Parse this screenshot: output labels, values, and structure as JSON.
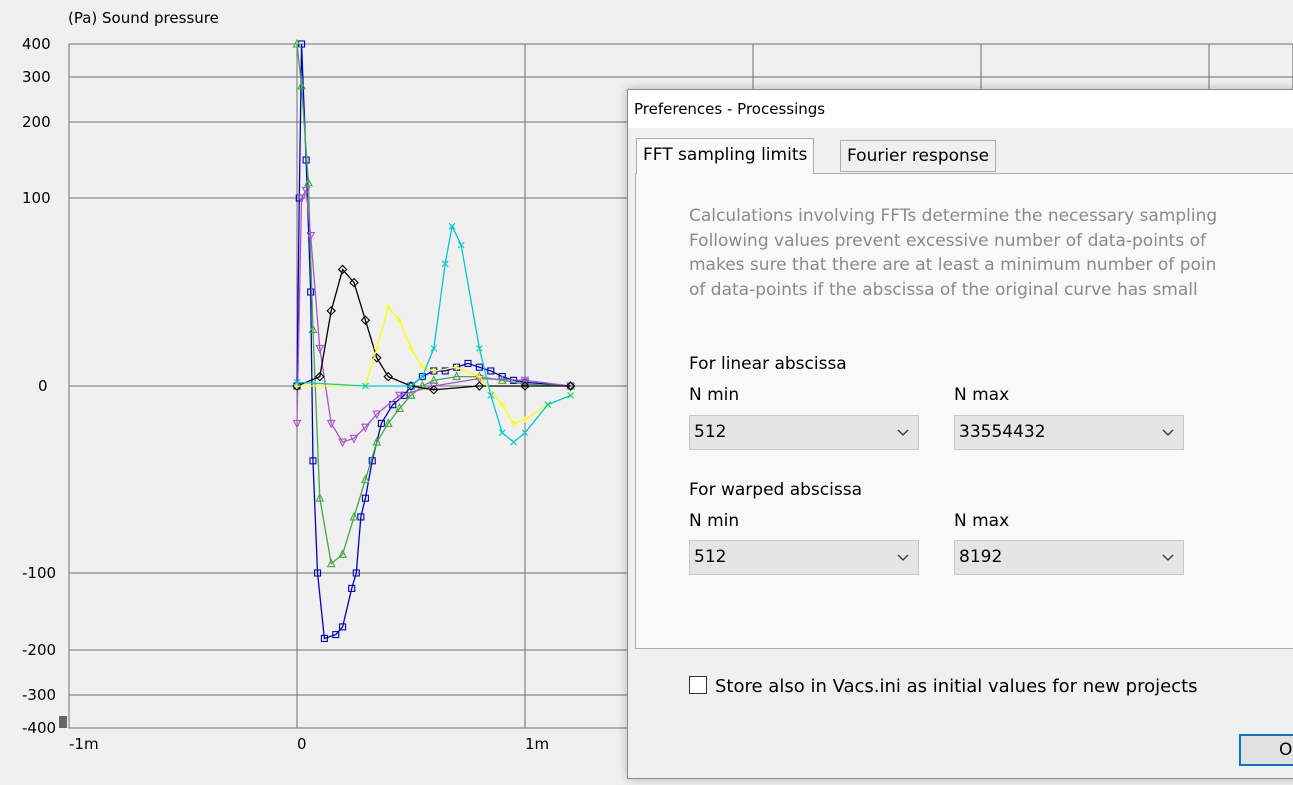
{
  "chart_data": {
    "type": "line",
    "title": "(Pa)  Sound pressure",
    "ylabel": "Sound pressure",
    "yunit": "(Pa)",
    "y_ticks": [
      "400",
      "300",
      "200",
      "100",
      "0",
      "-100",
      "-200",
      "-300",
      "-400"
    ],
    "x_ticks": [
      "-1m",
      "0",
      "1m"
    ],
    "xlim": [
      "-1m",
      "3m"
    ],
    "ylim": [
      -400,
      400
    ],
    "y_scale": "nonlinear (compressed near extremes)",
    "grid": true,
    "series": [
      {
        "color": "#0000cc",
        "marker": "square",
        "points": [
          [
            0,
            0
          ],
          [
            0.01,
            100
          ],
          [
            0.02,
            400
          ],
          [
            0.04,
            150
          ],
          [
            0.06,
            50
          ],
          [
            0.07,
            -40
          ],
          [
            0.09,
            -100
          ],
          [
            0.12,
            -185
          ],
          [
            0.17,
            -180
          ],
          [
            0.2,
            -170
          ],
          [
            0.24,
            -120
          ],
          [
            0.26,
            -100
          ],
          [
            0.28,
            -70
          ],
          [
            0.3,
            -60
          ],
          [
            0.33,
            -40
          ],
          [
            0.37,
            -20
          ],
          [
            0.42,
            -10
          ],
          [
            0.47,
            -5
          ],
          [
            0.5,
            0
          ],
          [
            0.55,
            5
          ],
          [
            0.6,
            8
          ],
          [
            0.65,
            8
          ],
          [
            0.7,
            10
          ],
          [
            0.75,
            12
          ],
          [
            0.8,
            10
          ],
          [
            0.85,
            8
          ],
          [
            0.9,
            5
          ],
          [
            0.95,
            3
          ],
          [
            1.0,
            2
          ],
          [
            1.2,
            0
          ]
        ]
      },
      {
        "color": "#44aa44",
        "marker": "triangle",
        "points": [
          [
            0,
            400
          ],
          [
            0.02,
            280
          ],
          [
            0.05,
            120
          ],
          [
            0.07,
            30
          ],
          [
            0.1,
            -60
          ],
          [
            0.15,
            -95
          ],
          [
            0.2,
            -90
          ],
          [
            0.25,
            -70
          ],
          [
            0.3,
            -50
          ],
          [
            0.35,
            -30
          ],
          [
            0.4,
            -20
          ],
          [
            0.45,
            -12
          ],
          [
            0.5,
            -5
          ],
          [
            0.55,
            0
          ],
          [
            0.6,
            3
          ],
          [
            0.7,
            5
          ],
          [
            0.8,
            5
          ],
          [
            0.9,
            3
          ],
          [
            1.0,
            1
          ],
          [
            1.2,
            0
          ]
        ]
      },
      {
        "color": "#aa55cc",
        "marker": "triangle-down",
        "points": [
          [
            0,
            -20
          ],
          [
            0.02,
            100
          ],
          [
            0.04,
            110
          ],
          [
            0.06,
            80
          ],
          [
            0.1,
            20
          ],
          [
            0.15,
            -20
          ],
          [
            0.2,
            -30
          ],
          [
            0.25,
            -28
          ],
          [
            0.3,
            -22
          ],
          [
            0.35,
            -15
          ],
          [
            0.45,
            -5
          ],
          [
            0.6,
            0
          ],
          [
            0.8,
            4
          ],
          [
            1.0,
            3
          ],
          [
            1.2,
            0
          ]
        ]
      },
      {
        "color": "#000000",
        "marker": "diamond",
        "points": [
          [
            0,
            0
          ],
          [
            0.1,
            5
          ],
          [
            0.15,
            40
          ],
          [
            0.2,
            62
          ],
          [
            0.25,
            55
          ],
          [
            0.3,
            35
          ],
          [
            0.35,
            15
          ],
          [
            0.4,
            5
          ],
          [
            0.5,
            0
          ],
          [
            0.6,
            -2
          ],
          [
            0.8,
            0
          ],
          [
            1.0,
            0
          ],
          [
            1.2,
            0
          ]
        ]
      },
      {
        "color": "#ffff00",
        "marker": "plus",
        "points": [
          [
            0,
            0
          ],
          [
            0.3,
            0
          ],
          [
            0.35,
            20
          ],
          [
            0.4,
            42
          ],
          [
            0.45,
            35
          ],
          [
            0.5,
            20
          ],
          [
            0.55,
            10
          ],
          [
            0.6,
            8
          ],
          [
            0.7,
            10
          ],
          [
            0.8,
            5
          ],
          [
            0.9,
            -10
          ],
          [
            0.95,
            -20
          ],
          [
            1.0,
            -18
          ],
          [
            1.1,
            -10
          ],
          [
            1.2,
            -5
          ]
        ]
      },
      {
        "color": "#00cccc",
        "marker": "x",
        "points": [
          [
            0,
            2
          ],
          [
            0.3,
            0
          ],
          [
            0.5,
            0
          ],
          [
            0.55,
            5
          ],
          [
            0.6,
            20
          ],
          [
            0.65,
            65
          ],
          [
            0.68,
            85
          ],
          [
            0.72,
            75
          ],
          [
            0.8,
            20
          ],
          [
            0.85,
            -5
          ],
          [
            0.9,
            -25
          ],
          [
            0.95,
            -30
          ],
          [
            1.0,
            -25
          ],
          [
            1.1,
            -10
          ],
          [
            1.2,
            -5
          ]
        ]
      }
    ]
  },
  "dialog": {
    "title": "Preferences - Processings",
    "tabs": [
      {
        "label": "FFT sampling limits",
        "active": true
      },
      {
        "label": "Fourier response",
        "active": false
      }
    ],
    "description": [
      "Calculations involving FFTs determine the necessary sampling",
      "Following values prevent excessive number of data-points of",
      "makes sure that there are at least a minimum number of poin",
      "of data-points if the abscissa of the original curve has small"
    ],
    "linear": {
      "heading": "For linear abscissa",
      "nmin_label": "N min",
      "nmax_label": "N max",
      "nmin_value": "512",
      "nmax_value": "33554432"
    },
    "warped": {
      "heading": "For warped abscissa",
      "nmin_label": "N min",
      "nmax_label": "N max",
      "nmin_value": "512",
      "nmax_value": "8192"
    },
    "store_checkbox": {
      "label": "Store also in Vacs.ini as initial values for new projects",
      "checked": false
    },
    "ok_label": "O"
  }
}
